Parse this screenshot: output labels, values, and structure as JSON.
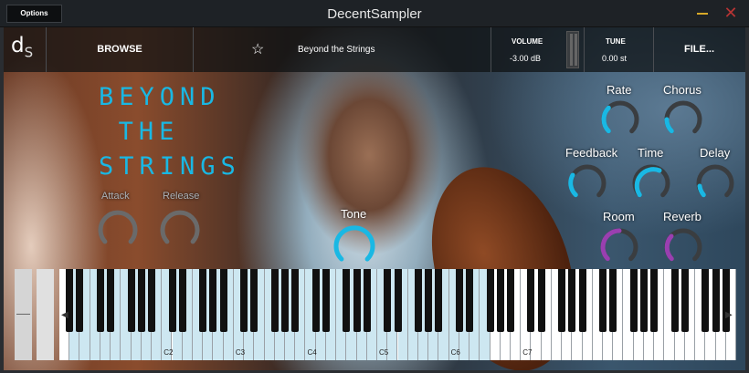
{
  "window": {
    "title": "DecentSampler",
    "options_label": "Options"
  },
  "topbar": {
    "logo": "d",
    "logo_sub": "S",
    "browse_label": "BROWSE",
    "preset_name": "Beyond the Strings",
    "volume_label": "VOLUME",
    "volume_value": "-3.00 dB",
    "tune_label": "TUNE",
    "tune_value": "0.00 st",
    "file_label": "FILE..."
  },
  "instrument": {
    "logo_lines": [
      "BEYOND",
      "THE",
      "STRINGS"
    ]
  },
  "controls": {
    "attack": "Attack",
    "release": "Release",
    "tone": "Tone",
    "rate": "Rate",
    "chorus": "Chorus",
    "feedback": "Feedback",
    "time": "Time",
    "delay": "Delay",
    "room": "Room",
    "reverb": "Reverb"
  },
  "keyboard": {
    "octave_labels": [
      "C2",
      "C3",
      "C4",
      "C5",
      "C6",
      "C7"
    ]
  },
  "colors": {
    "accent": "#19b8e4",
    "reverb_accent": "#9a3fb0",
    "key_active": "#cde7f1"
  }
}
